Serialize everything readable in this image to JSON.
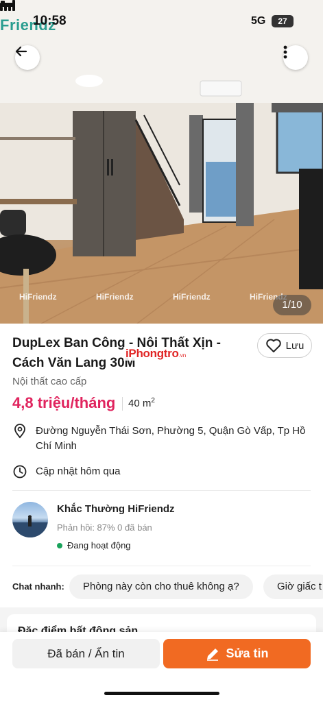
{
  "status_bar": {
    "time": "10:58",
    "network": "5G",
    "battery": "27",
    "brand_overlay": "Friendz"
  },
  "gallery": {
    "counter": "1/10",
    "watermark": "HiFriendz",
    "icons": {
      "back": "arrow-left-icon",
      "more": "more-vertical-icon"
    }
  },
  "listing": {
    "title": "DupLex Ban Công - Nội Thất Xịn - Cách Văn Lang 30M",
    "save_label": "Lưu",
    "stamp_text": "iPhongtro",
    "stamp_suffix": ".vn",
    "furniture": "Nội thất cao cấp",
    "price": "4,8 triệu/tháng",
    "area": "40 m",
    "area_unit_sup": "2",
    "address": "Đường Nguyễn Thái Sơn, Phường 5, Quận Gò Vấp, Tp Hồ Chí Minh",
    "updated": "Cập nhật hôm qua",
    "colors": {
      "price": "#e0245e",
      "accent": "#f16a22",
      "online": "#19a35b"
    }
  },
  "seller": {
    "name": "Khắc Thường HiFriendz",
    "stats": "Phản hồi: 87%   0 đã bán",
    "status": "Đang hoạt động"
  },
  "quick_chat": {
    "label": "Chat nhanh:",
    "chips": [
      "Phòng này còn cho thuê không ạ?",
      "Giờ giấc t"
    ]
  },
  "section": {
    "title": "Đặc điểm bất động sản"
  },
  "actions": {
    "sold_hide": "Đã bán / Ẩn tin",
    "edit": "Sửa tin"
  }
}
